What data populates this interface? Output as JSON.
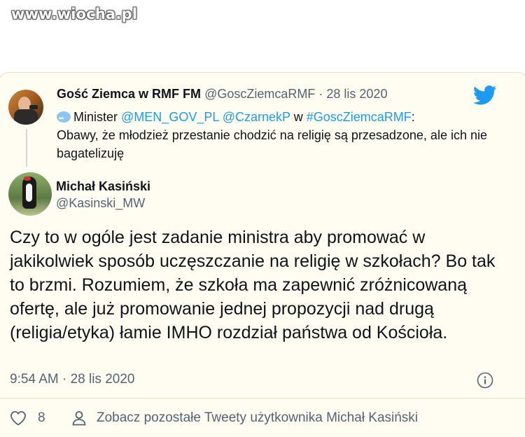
{
  "watermark": "www.wiocha.pl",
  "quoted_tweet": {
    "name": "Gość Ziemca w RMF FM",
    "handle": "@GoscZiemcaRMF",
    "separator": "·",
    "date": "28 lis 2020",
    "text_prefix": "Minister",
    "mention1": "@MEN_GOV_PL",
    "mention2": "@CzarnekP",
    "text_w": "w",
    "hashtag": "#GoscZiemcaRMF",
    "colon": ":",
    "text_body": "Obawy, że młodzież przestanie chodzić na religię są przesadzone, ale ich nie bagatelizuję"
  },
  "tweet": {
    "name": "Michał Kasiński",
    "handle": "@Kasinski_MW",
    "text": "Czy to w ogóle jest zadanie ministra aby promować w jakikolwiek sposób uczęszczanie na religię w szkołach? Bo tak to brzmi. Rozumiem, że szkoła ma zapewnić zróżnicowaną ofertę, ale już promowanie jednej propozycji nad drugą (religia/etyka) łamie IMHO rozdział państwa od Kościoła.",
    "timestamp": "9:54 AM · 28 lis 2020"
  },
  "footer": {
    "like_count": "8",
    "see_more": "Zobacz pozostałe Tweety użytkownika Michał Kasiński"
  },
  "colors": {
    "twitter_blue": "#1d9bf0",
    "secondary_text": "#536471",
    "card_background": "#fffdf2"
  },
  "icons": [
    "twitter-bird-icon",
    "speech-bubble-icon",
    "info-icon",
    "heart-icon",
    "person-icon"
  ]
}
